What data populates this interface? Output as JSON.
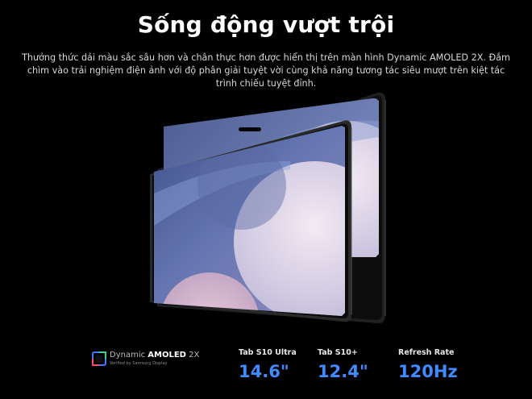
{
  "header": {
    "title": "Sống động vượt trội",
    "description": "Thưởng thức dải màu sắc sâu hơn và chân thực hơn được hiển thị trên màn hình Dynamic AMOLED 2X. Đắm chìm vào trải nghiệm điện ảnh với độ phân giải tuyệt vời cùng khả năng tương tác siêu mượt trên kiệt tác trình chiếu tuyệt đỉnh."
  },
  "badge": {
    "brand_prefix": "Dynamic ",
    "brand_emphasis": "AMOLED",
    "brand_suffix": " 2X",
    "subtext": "Verified by Samsung Display"
  },
  "specs": [
    {
      "label": "Tab S10 Ultra",
      "value": "14.6\""
    },
    {
      "label": "Tab S10+",
      "value": "12.4\""
    },
    {
      "label": "Refresh Rate",
      "value": "120Hz"
    }
  ],
  "colors": {
    "accent": "#3f8bff",
    "background": "#000000"
  }
}
